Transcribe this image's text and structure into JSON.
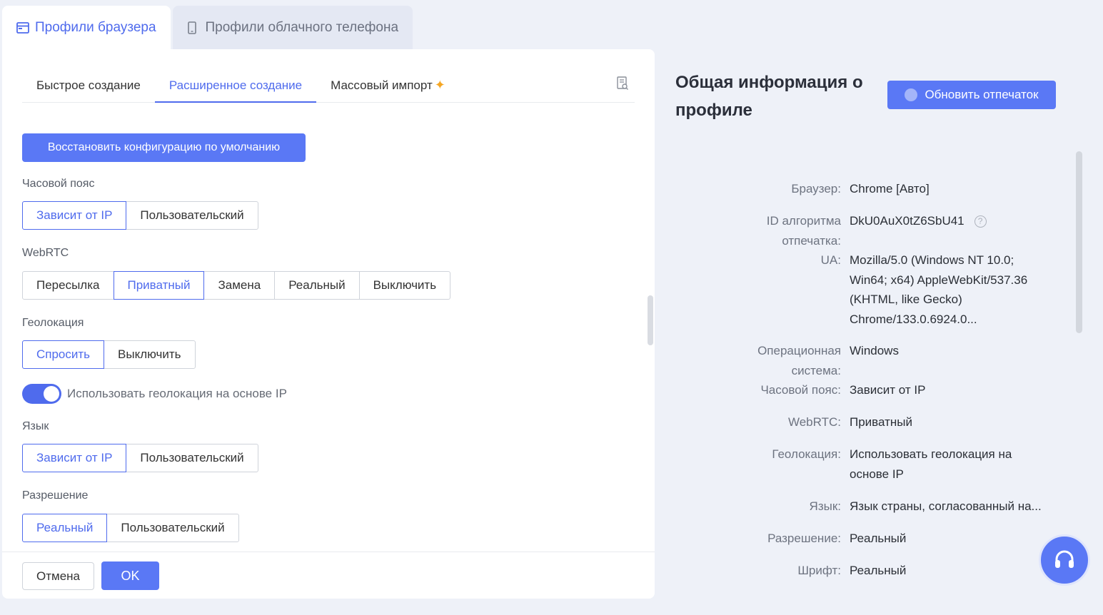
{
  "top_tabs": [
    {
      "label": "Профили браузера",
      "icon": "browser-window-icon"
    },
    {
      "label": "Профили облачного телефона",
      "icon": "phone-icon"
    }
  ],
  "sub_tabs": [
    "Быстрое создание",
    "Расширенное создание",
    "Массовый импорт"
  ],
  "restore_button": "Восстановить конфигурацию по умолчанию",
  "timezone": {
    "label": "Часовой пояс",
    "options": [
      "Зависит от IP",
      "Пользовательский"
    ],
    "selected": "Зависит от IP"
  },
  "webrtc": {
    "label": "WebRTC",
    "options": [
      "Пересылка",
      "Приватный",
      "Замена",
      "Реальный",
      "Выключить"
    ],
    "selected": "Приватный"
  },
  "geolocation": {
    "label": "Геолокация",
    "options": [
      "Спросить",
      "Выключить"
    ],
    "selected": "Спросить"
  },
  "geo_toggle": {
    "label": "Использовать геолокация на основе IP",
    "on": true
  },
  "language": {
    "label": "Язык",
    "options": [
      "Зависит от IP",
      "Пользовательский"
    ],
    "selected": "Зависит от IP"
  },
  "resolution": {
    "label": "Разрешение",
    "options": [
      "Реальный",
      "Пользовательский"
    ],
    "selected": "Реальный"
  },
  "footer": {
    "cancel": "Отмена",
    "ok": "OK"
  },
  "info": {
    "title": "Общая информация о профиле",
    "refresh_button": "Обновить отпечаток",
    "rows": [
      {
        "key": "Браузер:",
        "value": "Chrome [Авто]"
      },
      {
        "key": "ID алгоритма отпечатка:",
        "value": "DkU0AuX0tZ6SbU41"
      },
      {
        "key": "UA:",
        "value": "Mozilla/5.0 (Windows NT 10.0; Win64; x64) AppleWebKit/537.36 (KHTML, like Gecko) Chrome/133.0.6924.0..."
      },
      {
        "key": "Операционная система:",
        "value": "Windows"
      },
      {
        "key": "Часовой пояс:",
        "value": "Зависит от IP"
      },
      {
        "key": "WebRTC:",
        "value": "Приватный"
      },
      {
        "key": "Геолокация:",
        "value": "Использовать геолокация на основе IP"
      },
      {
        "key": "Язык:",
        "value": "Язык страны, согласованный на..."
      },
      {
        "key": "Разрешение:",
        "value": "Реальный"
      },
      {
        "key": "Шрифт:",
        "value": "Реальный"
      }
    ]
  },
  "colors": {
    "accent": "#4f6bed",
    "button": "#5a78f5",
    "background": "#eef1f8"
  }
}
